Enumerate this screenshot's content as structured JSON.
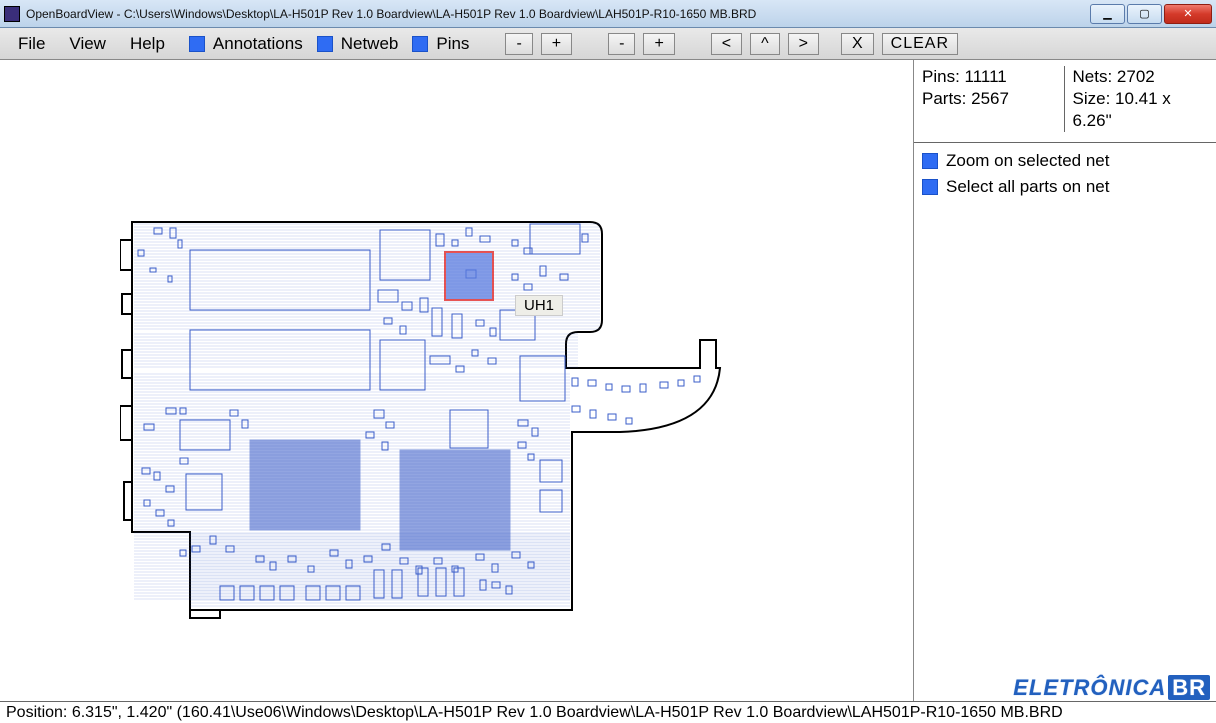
{
  "window": {
    "title": "OpenBoardView - C:\\Users\\Windows\\Desktop\\LA-H501P Rev 1.0 Boardview\\LA-H501P Rev 1.0 Boardview\\LAH501P-R10-1650 MB.BRD"
  },
  "menu": {
    "file": "File",
    "view": "View",
    "help": "Help"
  },
  "toggles": {
    "annotations": "Annotations",
    "netweb": "Netweb",
    "pins": "Pins"
  },
  "nav": {
    "zoom_out": "-",
    "zoom_in": "+",
    "zoom_out2": "-",
    "zoom_in2": "+",
    "left": "<",
    "up": "^",
    "right": ">",
    "x": "X",
    "clear": "CLEAR"
  },
  "stats": {
    "pins_label": "Pins:",
    "pins_value": "11111",
    "parts_label": "Parts:",
    "parts_value": "2567",
    "nets_label": "Nets:",
    "nets_value": "2702",
    "size_label": "Size:",
    "size_value": "10.41 x 6.26\""
  },
  "options": {
    "zoom_net": "Zoom on selected net",
    "select_parts": "Select all parts on net"
  },
  "selected_component": "UH1",
  "status": "Position: 6.315\", 1.420\" (160.41\\Use06\\Windows\\Desktop\\LA-H501P Rev 1.0 Boardview\\LA-H501P Rev 1.0 Boardview\\LAH501P-R10-1650 MB.BRD",
  "watermark": {
    "text": "ELETRÔNICA",
    "suffix": "BR"
  }
}
